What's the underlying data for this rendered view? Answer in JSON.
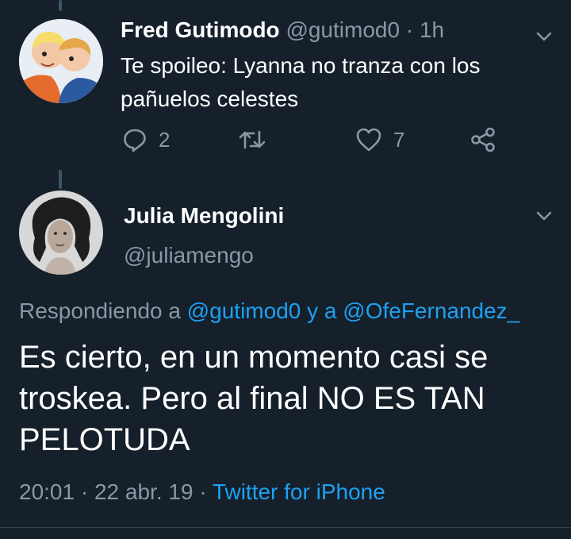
{
  "tweet1": {
    "display_name": "Fred Gutimodo",
    "handle": "@gutimod0",
    "separator": "·",
    "time": "1h",
    "text": "Te spoileo: Lyanna no tranza con los pañuelos celestes",
    "reply_count": "2",
    "like_count": "7",
    "icons": [
      "reply-icon",
      "retweet-icon",
      "like-icon",
      "share-icon",
      "chevron-down-icon"
    ]
  },
  "tweet2": {
    "display_name": "Julia Mengolini",
    "handle": "@juliamengo",
    "replying_prefix": "Respondiendo a",
    "reply_to_1": "@gutimod0",
    "reply_conjunction": "y a",
    "reply_to_2": "@OfeFernandez_",
    "text": "Es cierto, en un momento casi se troskea. Pero al final NO ES TAN PELOTUDA",
    "time": "20:01",
    "date": "22 abr. 19",
    "source": "Twitter for iPhone",
    "separator": "·"
  },
  "colors": {
    "background": "#15202b",
    "text": "#ffffff",
    "muted": "#8899a6",
    "link": "#1da1f2",
    "divider": "#38444d",
    "thread_line": "#3d5466"
  }
}
